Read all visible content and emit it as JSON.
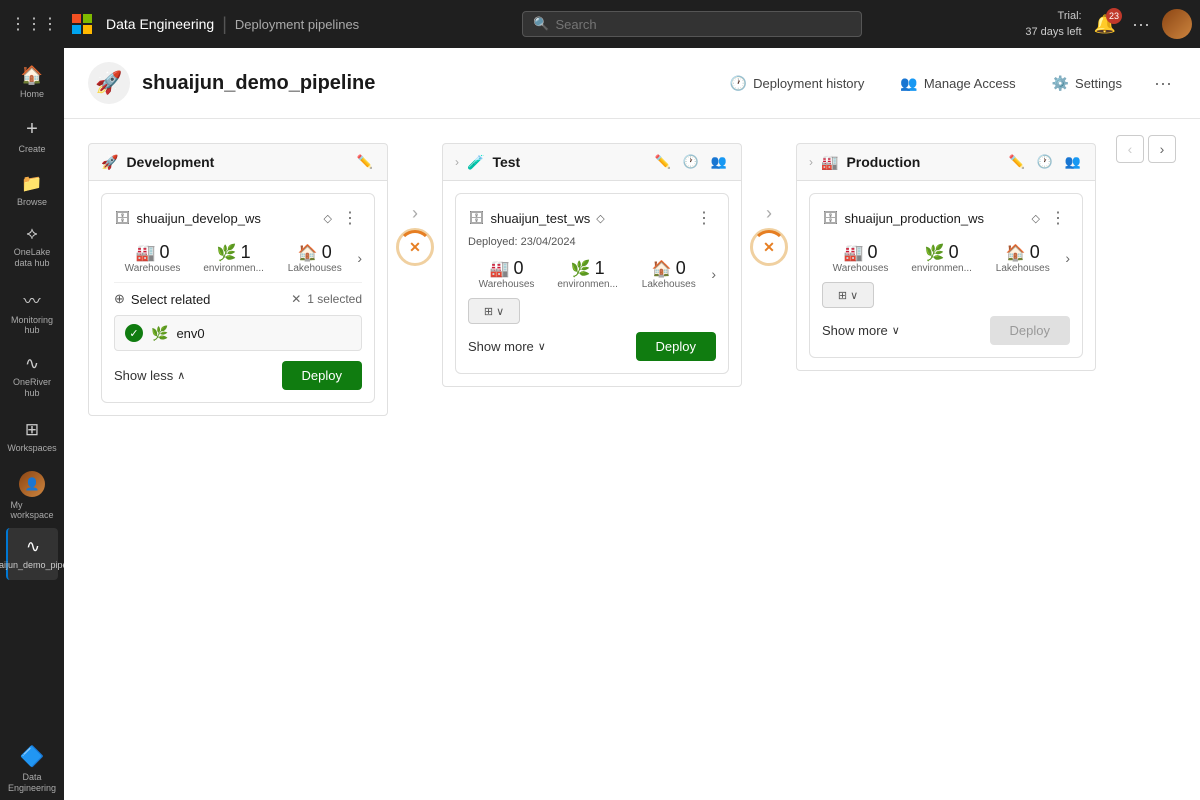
{
  "topbar": {
    "brand": "Data Engineering",
    "subtitle": "Deployment pipelines",
    "search_placeholder": "Search",
    "trial_line1": "Trial:",
    "trial_line2": "37 days left",
    "notif_count": "23"
  },
  "sidebar": {
    "items": [
      {
        "id": "home",
        "label": "Home",
        "icon": "⊞"
      },
      {
        "id": "create",
        "label": "Create",
        "icon": "+"
      },
      {
        "id": "browse",
        "label": "Browse",
        "icon": "📁"
      },
      {
        "id": "onelake",
        "label": "OneLake data hub",
        "icon": "⟁"
      },
      {
        "id": "monitoring",
        "label": "Monitoring hub",
        "icon": "〰"
      },
      {
        "id": "oneriver",
        "label": "OneRiver hub",
        "icon": "∿"
      },
      {
        "id": "workspaces",
        "label": "Workspaces",
        "icon": "⊞"
      },
      {
        "id": "my_workspace",
        "label": "My workspace",
        "icon": "👤"
      },
      {
        "id": "pipeline",
        "label": "shuaijun_demo_pipeline",
        "icon": "∿"
      }
    ]
  },
  "header": {
    "pipeline_icon": "🚀",
    "title": "shuaijun_demo_pipeline",
    "actions": {
      "deployment_history": "Deployment history",
      "manage_access": "Manage Access",
      "settings": "Settings"
    }
  },
  "stages": {
    "development": {
      "title": "Development",
      "workspace": {
        "name": "shuaijun_develop_ws",
        "deployed": "",
        "stats": {
          "warehouses": {
            "count": "0",
            "label": "Warehouses"
          },
          "environments": {
            "count": "1",
            "label": "environmen..."
          },
          "lakehouses": {
            "count": "0",
            "label": "Lakehouses"
          }
        }
      },
      "select_related_label": "Select related",
      "selected_count": "1 selected",
      "env_item": "env0",
      "show_less_label": "Show less",
      "deploy_label": "Deploy"
    },
    "test": {
      "title": "Test",
      "workspace": {
        "name": "shuaijun_test_ws",
        "deployed": "Deployed: 23/04/2024",
        "stats": {
          "warehouses": {
            "count": "0",
            "label": "Warehouses"
          },
          "environments": {
            "count": "1",
            "label": "environmen..."
          },
          "lakehouses": {
            "count": "0",
            "label": "Lakehouses"
          }
        }
      },
      "show_more_label": "Show more",
      "deploy_label": "Deploy"
    },
    "production": {
      "title": "Production",
      "workspace": {
        "name": "shuaijun_production_ws",
        "deployed": "",
        "stats": {
          "warehouses": {
            "count": "0",
            "label": "Warehouses"
          },
          "environments": {
            "count": "0",
            "label": "environmen..."
          },
          "lakehouses": {
            "count": "0",
            "label": "Lakehouses"
          }
        }
      },
      "show_more_label": "Show more",
      "deploy_label": "Deploy"
    }
  }
}
